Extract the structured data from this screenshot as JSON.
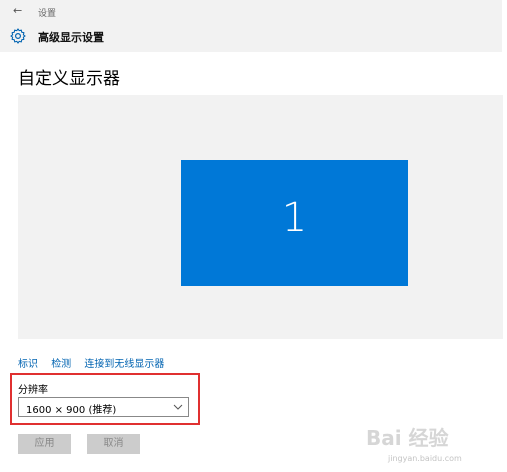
{
  "window": {
    "app_title": "设置",
    "back_icon": "back-arrow-icon",
    "section_icon": "gear-icon",
    "section_title": "高级显示设置"
  },
  "page": {
    "heading": "自定义显示器"
  },
  "display_preview": {
    "monitor_label": "1",
    "monitor_color": "#0078d7",
    "background_color": "#f2f2f2"
  },
  "links": [
    {
      "label": "标识"
    },
    {
      "label": "检测"
    },
    {
      "label": "连接到无线显示器"
    }
  ],
  "resolution": {
    "label": "分辨率",
    "selected": "1600 × 900 (推荐)",
    "dropdown_icon": "chevron-down-icon",
    "highlight_color": "#e03030"
  },
  "buttons": {
    "apply": "应用",
    "cancel": "取消"
  },
  "watermark": {
    "text": "Bai 经验",
    "url": "jingyan.baidu.com"
  }
}
